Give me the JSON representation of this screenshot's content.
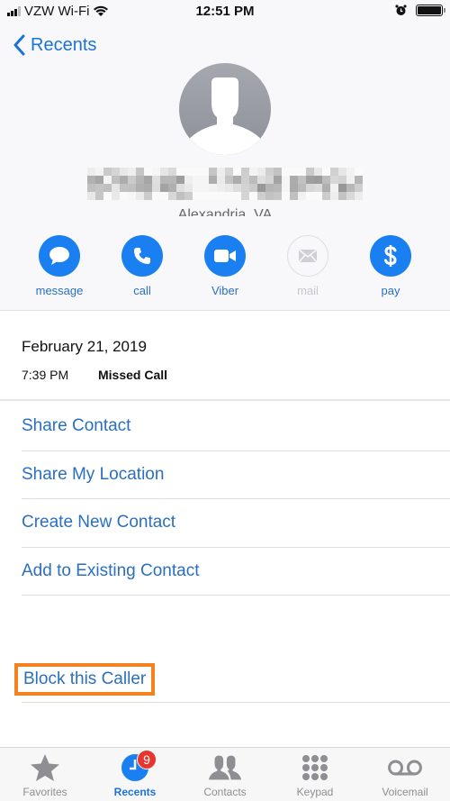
{
  "status_bar": {
    "carrier": "VZW Wi-Fi",
    "time": "12:51 PM",
    "signal_bars_filled": 3,
    "signal_bars_total": 4,
    "icons": [
      "signal-icon",
      "wifi-icon",
      "alarm-icon",
      "battery-icon"
    ]
  },
  "nav": {
    "back_label": "Recents"
  },
  "contact": {
    "name_redacted": true,
    "location": "Alexandria, VA",
    "avatar": "person-silhouette-icon"
  },
  "actions": [
    {
      "id": "message",
      "label": "message",
      "icon": "message-bubble-icon",
      "enabled": true
    },
    {
      "id": "call",
      "label": "call",
      "icon": "phone-icon",
      "enabled": true
    },
    {
      "id": "viber",
      "label": "Viber",
      "icon": "video-camera-icon",
      "enabled": true
    },
    {
      "id": "mail",
      "label": "mail",
      "icon": "envelope-icon",
      "enabled": false
    },
    {
      "id": "pay",
      "label": "pay",
      "icon": "dollar-icon",
      "enabled": true
    }
  ],
  "call_log": {
    "date": "February 21, 2019",
    "time": "7:39 PM",
    "type": "Missed Call"
  },
  "options": [
    {
      "label": "Share Contact"
    },
    {
      "label": "Share My Location"
    },
    {
      "label": "Create New Contact"
    },
    {
      "label": "Add to Existing Contact"
    }
  ],
  "block": {
    "label": "Block this Caller",
    "highlight_color": "#f58220"
  },
  "tab_bar": {
    "tabs": [
      {
        "label": "Favorites",
        "icon": "star-icon",
        "active": false
      },
      {
        "label": "Recents",
        "icon": "clock-icon",
        "active": true,
        "badge": "9"
      },
      {
        "label": "Contacts",
        "icon": "contacts-icon",
        "active": false
      },
      {
        "label": "Keypad",
        "icon": "keypad-icon",
        "active": false
      },
      {
        "label": "Voicemail",
        "icon": "voicemail-icon",
        "active": false
      }
    ]
  },
  "colors": {
    "accent": "#1a7ff0",
    "link": "#2a6fc0",
    "badge": "#e8352f",
    "inactive": "#8e8e93"
  }
}
